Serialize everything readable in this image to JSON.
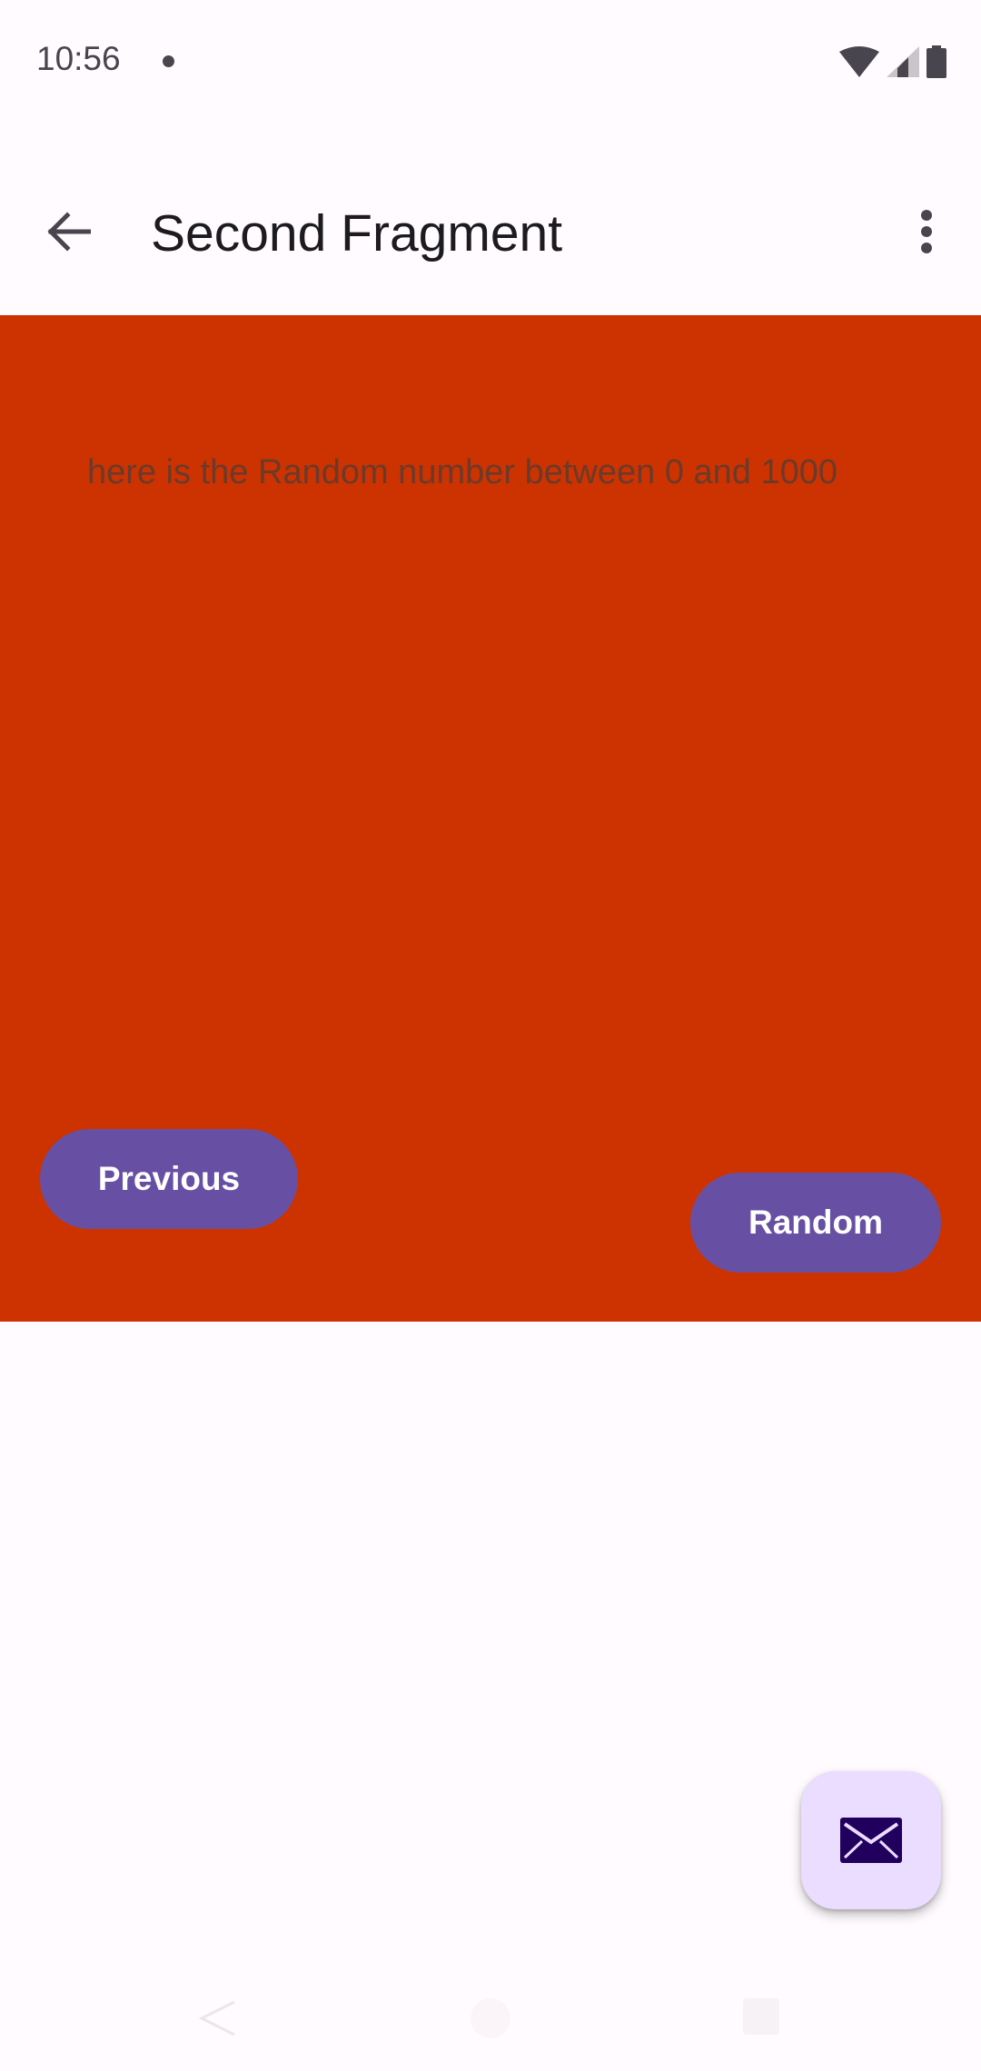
{
  "status_bar": {
    "time": "10:56"
  },
  "app_bar": {
    "title": "Second Fragment",
    "back_icon": "arrow-back-icon",
    "overflow_icon": "more-vert-icon"
  },
  "content": {
    "message": "here is the Random number between 0 and 1000",
    "background_color": "#cc3300",
    "previous_label": "Previous",
    "random_label": "Random",
    "button_color": "#6750a4"
  },
  "fab": {
    "icon": "mail-icon",
    "color": "#eaddff"
  }
}
